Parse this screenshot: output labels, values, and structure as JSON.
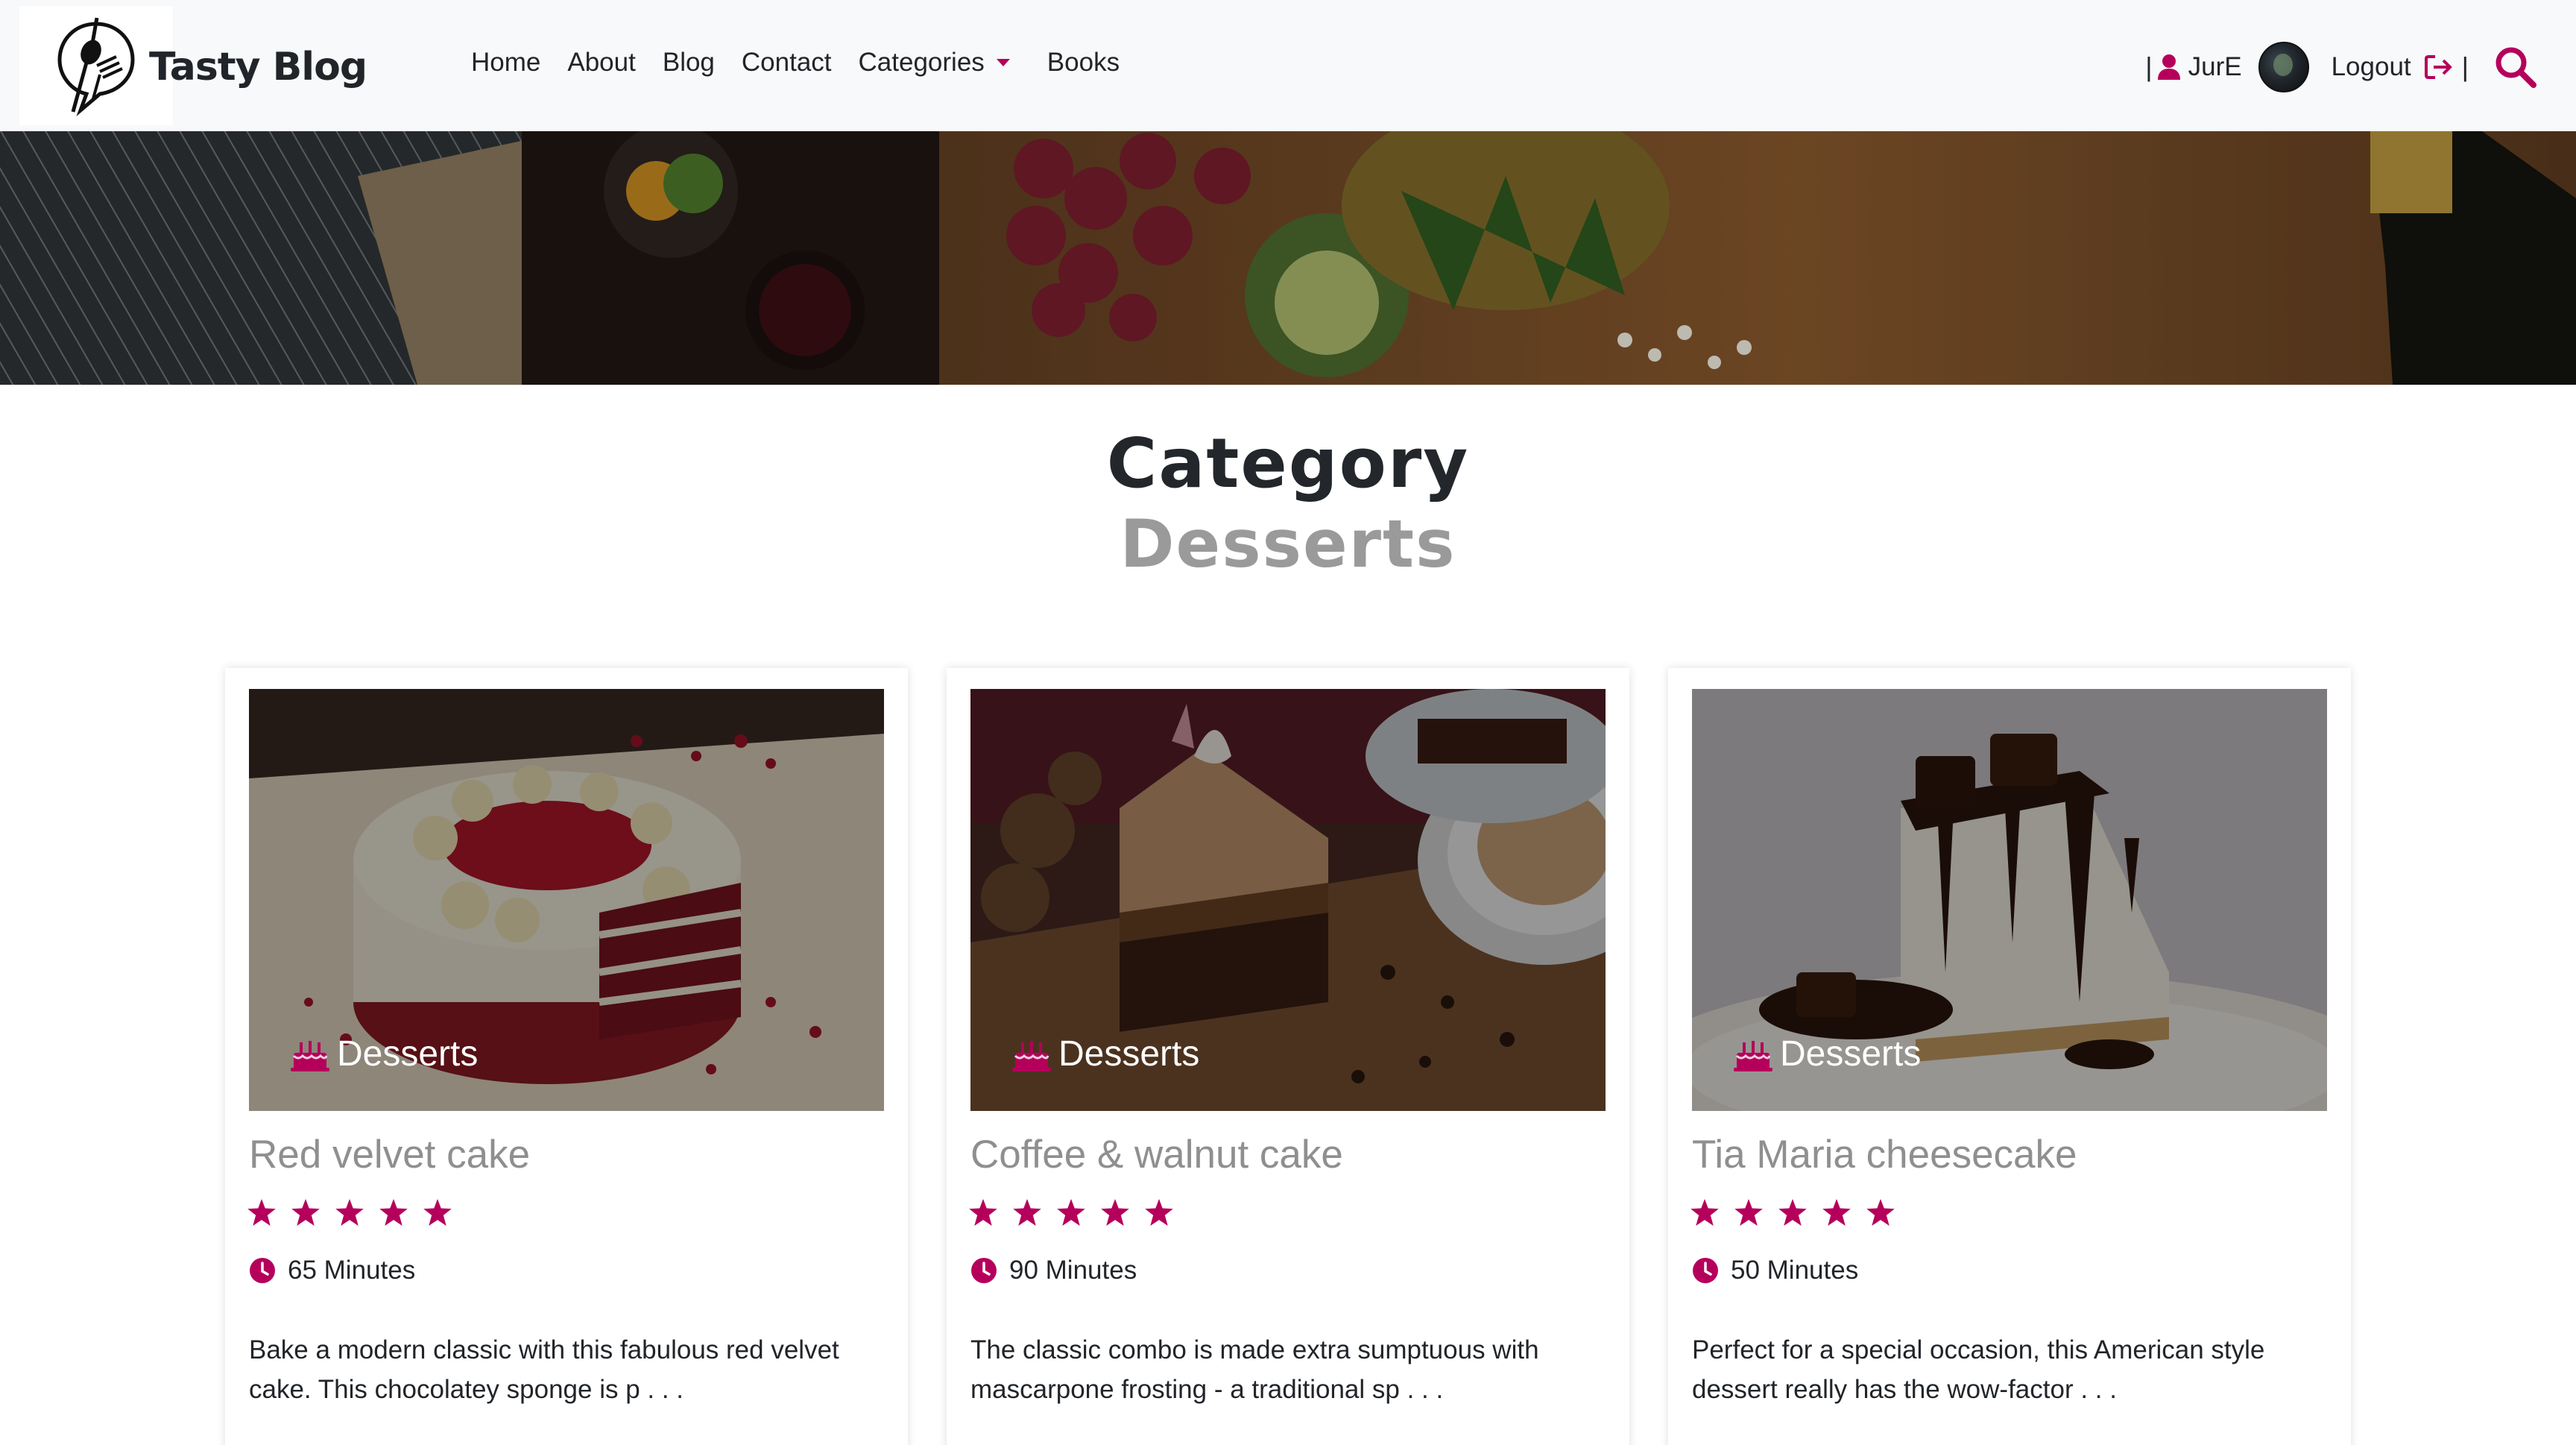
{
  "brand": {
    "name": "Tasty Blog"
  },
  "nav": {
    "links": [
      "Home",
      "About",
      "Blog",
      "Contact",
      "Categories",
      "Books"
    ]
  },
  "user": {
    "separator": "|",
    "name": "JurE",
    "logout_label": "Logout"
  },
  "icons": {
    "logo": "spoon-fork-chat-icon",
    "user": "user-icon",
    "logout": "logout-icon",
    "search": "search-icon",
    "category": "cake-icon",
    "star": "star-icon",
    "clock": "clock-icon"
  },
  "colors": {
    "accent": "#b5005b",
    "muted_title": "#8f8f8f"
  },
  "heading": {
    "title": "Category",
    "subtitle": "Desserts"
  },
  "cards": [
    {
      "category": "Desserts",
      "title": "Red velvet cake",
      "rating": 5,
      "time": "65 Minutes",
      "description": "Bake a modern classic with this fabulous red velvet cake. This chocolatey sponge is p . . ."
    },
    {
      "category": "Desserts",
      "title": "Coffee & walnut cake",
      "rating": 5,
      "time": "90 Minutes",
      "description": "The classic combo is made extra sumptuous with mascarpone frosting - a traditional sp . . ."
    },
    {
      "category": "Desserts",
      "title": "Tia Maria cheesecake",
      "rating": 5,
      "time": "50 Minutes",
      "description": "Perfect for a special occasion, this American style dessert really has the wow-factor . . ."
    }
  ]
}
